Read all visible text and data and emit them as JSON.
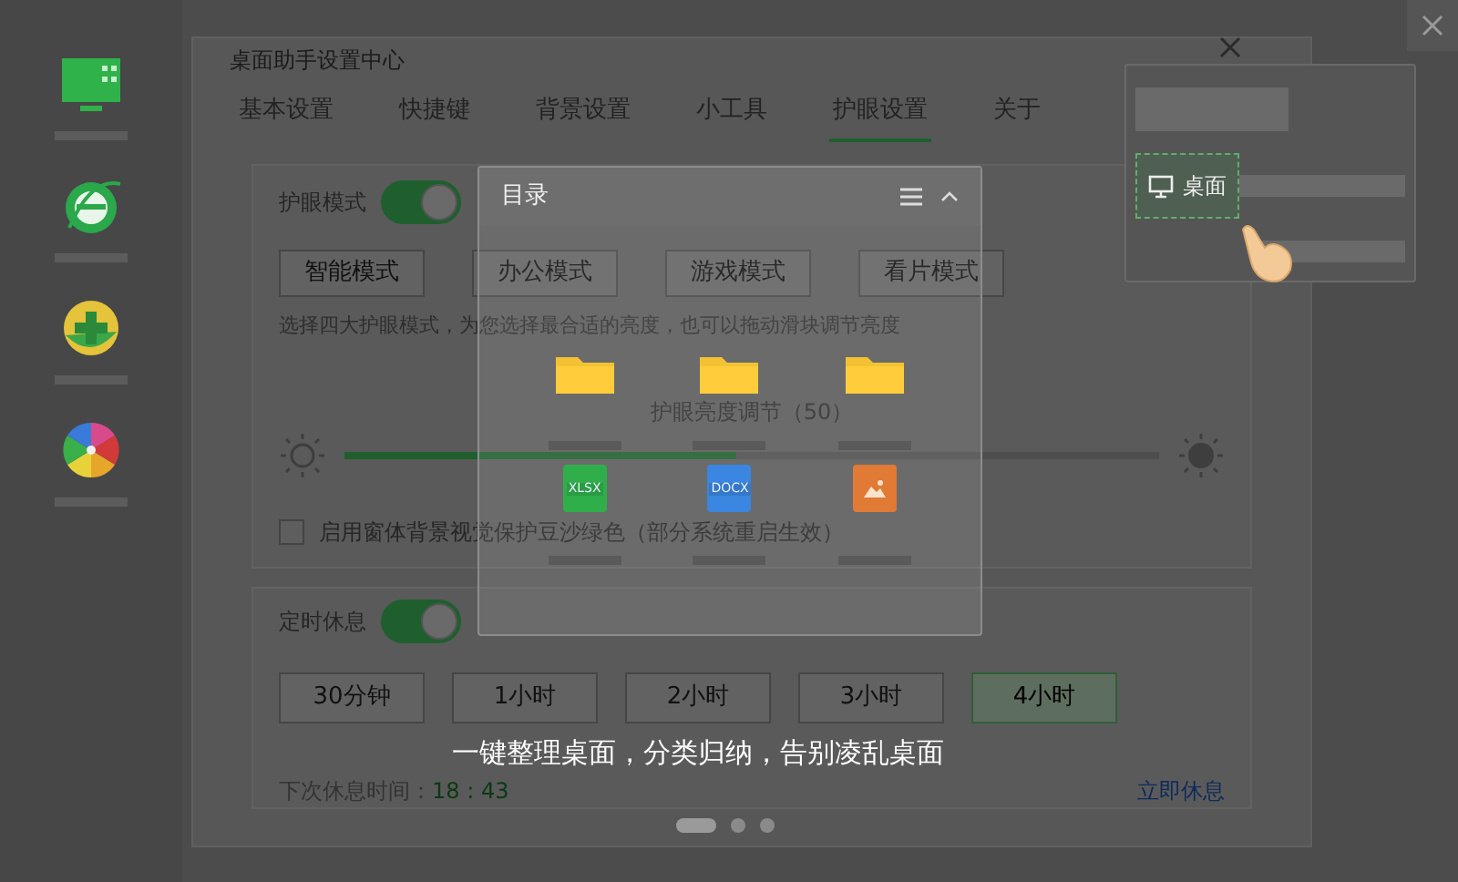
{
  "dock_apps": [
    {
      "kind": "monitor"
    },
    {
      "kind": "browser"
    },
    {
      "kind": "plus"
    },
    {
      "kind": "pinwheel"
    }
  ],
  "dialog": {
    "title": "桌面助手设置中心",
    "tabs": [
      {
        "label": "基本设置",
        "selected": false
      },
      {
        "label": "快捷键",
        "selected": false
      },
      {
        "label": "背景设置",
        "selected": false
      },
      {
        "label": "小工具",
        "selected": false
      },
      {
        "label": "护眼设置",
        "selected": true
      },
      {
        "label": "关于",
        "selected": false
      }
    ]
  },
  "eye_care": {
    "label": "护眼模式",
    "on": true,
    "modes": [
      "智能模式",
      "办公模式",
      "游戏模式",
      "看片模式"
    ],
    "description": "选择四大护眼模式，为您选择最合适的亮度，也可以拖动滑块调节亮度",
    "brightness_label": "护眼亮度调节（50）",
    "brightness": {
      "level": 0.48
    },
    "checkbox": {
      "label": "启用窗体背景视觉保护豆沙绿色（部分系统重启生效）",
      "checked": false
    }
  },
  "rest": {
    "label": "定时休息",
    "on": true,
    "durations": [
      {
        "label": "30分钟",
        "selected": false
      },
      {
        "label": "1小时",
        "selected": false
      },
      {
        "label": "2小时",
        "selected": false
      },
      {
        "label": "3小时",
        "selected": false
      },
      {
        "label": "4小时",
        "selected": true
      }
    ],
    "next_label": "下次休息时间：",
    "next_time": "18 : 43",
    "rest_now": "立即休息"
  },
  "folder_panel": {
    "title": "目录",
    "folders": [
      {
        "kind": "folder"
      },
      {
        "kind": "folder"
      },
      {
        "kind": "folder"
      }
    ],
    "files": [
      {
        "kind": "xlsx",
        "label": "XLSX"
      },
      {
        "kind": "docx",
        "label": "DOCX"
      },
      {
        "kind": "image"
      }
    ]
  },
  "desktop_card": {
    "chip": "桌面"
  },
  "caption": "一键整理桌面，分类归纳，告别凌乱桌面",
  "pager": [
    {
      "selected": true
    },
    {
      "selected": false
    },
    {
      "selected": false
    }
  ]
}
